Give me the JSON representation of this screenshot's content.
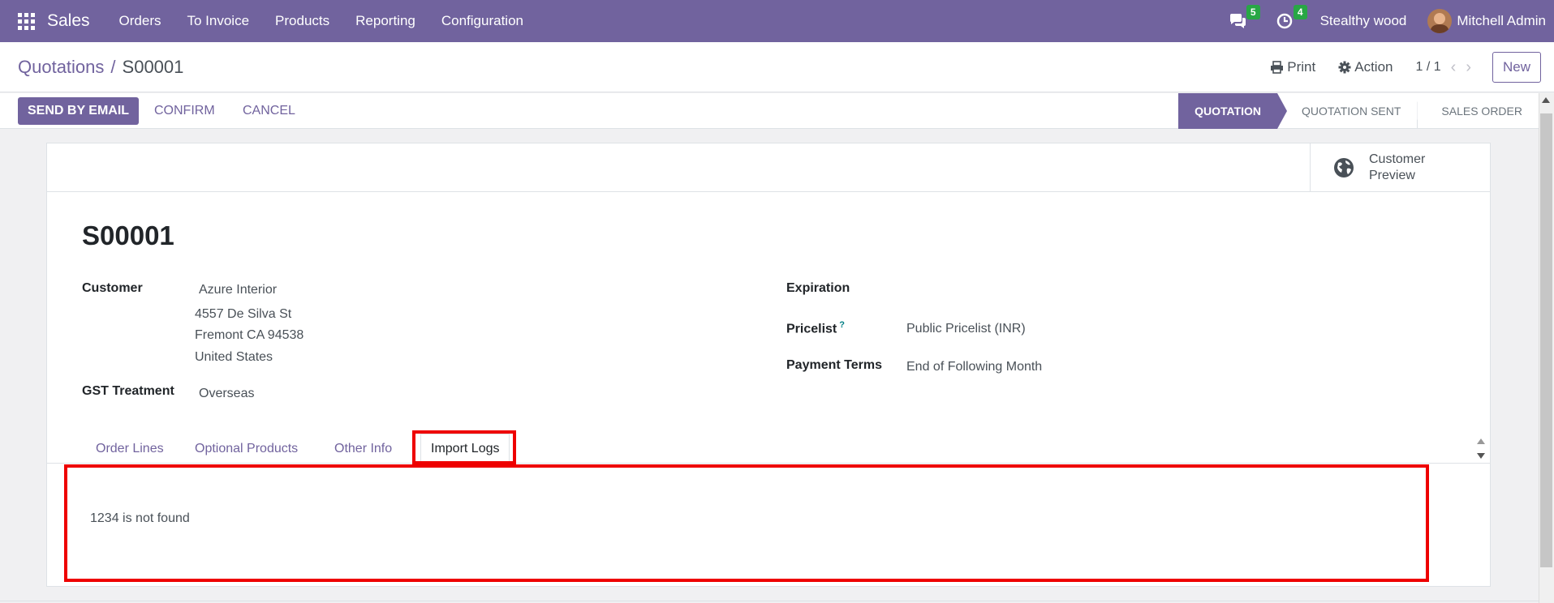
{
  "navbar": {
    "app_name": "Sales",
    "menu": [
      "Orders",
      "To Invoice",
      "Products",
      "Reporting",
      "Configuration"
    ],
    "messages_count": "5",
    "activities_count": "4",
    "company": "Stealthy wood",
    "user": "Mitchell Admin",
    "color": "#71639e"
  },
  "control": {
    "breadcrumb_parent": "Quotations",
    "breadcrumb_sep": "/",
    "breadcrumb_current": "S00001",
    "print_label": "Print",
    "action_label": "Action",
    "pager": "1 / 1",
    "new_label": "New"
  },
  "statusbar": {
    "send_email": "SEND BY EMAIL",
    "confirm": "CONFIRM",
    "cancel": "CANCEL",
    "stages": [
      "QUOTATION",
      "QUOTATION SENT",
      "SALES ORDER"
    ],
    "active_stage": "QUOTATION"
  },
  "form": {
    "preview_label": "Customer Preview",
    "name": "S00001",
    "customer_label": "Customer",
    "customer_name": "Azure Interior",
    "address_line1": "4557 De Silva St",
    "address_line2": "Fremont CA 94538",
    "address_line3": "United States",
    "gst_label": "GST Treatment",
    "gst_value": "Overseas",
    "expiration_label": "Expiration",
    "pricelist_label": "Pricelist",
    "pricelist_help": "?",
    "pricelist_value": "Public Pricelist (INR)",
    "payment_terms_label": "Payment Terms",
    "payment_terms_value": "End of Following Month"
  },
  "tabs": {
    "items": [
      "Order Lines",
      "Optional Products",
      "Other Info",
      "Import Logs"
    ],
    "active": "Import Logs"
  },
  "import_logs": {
    "message": "1234 is not found"
  }
}
